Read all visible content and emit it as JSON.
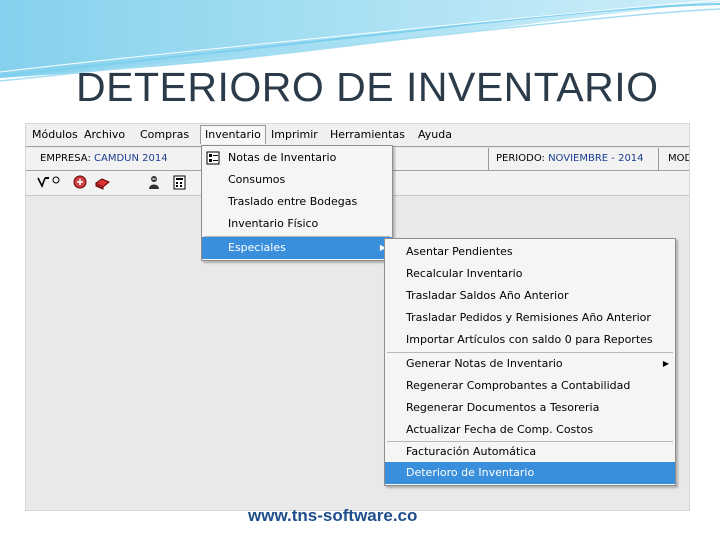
{
  "slide": {
    "title": "DETERIORO DE INVENTARIO",
    "footer_url": "www.tns-software.co"
  },
  "menubar": [
    "Módulos",
    "Archivo",
    "Compras",
    "Inventario",
    "Imprimir",
    "Herramientas",
    "Ayuda"
  ],
  "infobar": {
    "empresa_label": "EMPRESA:",
    "empresa_value": "CAMDUN 2014",
    "periodo_label": "PERIODO:",
    "periodo_value": "NOVIEMBRE - 2014",
    "extra": "MOD"
  },
  "toolbar_icons": [
    "pointer-icon",
    "circle-icon",
    "form-icon",
    "box-icon",
    "user-icon",
    "calculator-icon"
  ],
  "inventario_menu": [
    "Notas de Inventario",
    "Consumos",
    "Traslado entre Bodegas",
    "Inventario Físico",
    "Especiales"
  ],
  "especiales_menu": [
    "Asentar Pendientes",
    "Recalcular Inventario",
    "Trasladar Saldos Año Anterior",
    "Trasladar Pedidos y Remisiones Año Anterior",
    "Importar Artículos con saldo 0 para Reportes",
    "Generar Notas de Inventario",
    "Regenerar Comprobantes a Contabilidad",
    "Regenerar Documentos a Tesoreria",
    "Actualizar Fecha de Comp. Costos",
    "Facturación Automática",
    "Deterioro de Inventario"
  ],
  "colors": {
    "highlight": "#3a8fdc",
    "title": "#2b3b4a",
    "url": "#1e4e8c"
  }
}
